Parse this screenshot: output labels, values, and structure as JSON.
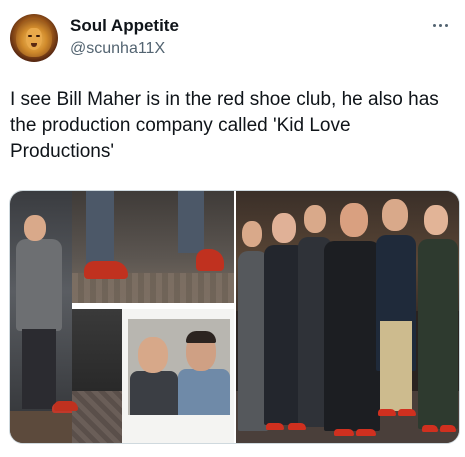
{
  "author": {
    "display_name": "Soul Appetite",
    "handle": "@scunha11X",
    "avatar_icon": "lion-avatar"
  },
  "menu": {
    "more_icon": "more-horizontal-icon"
  },
  "tweet": {
    "text": "I see Bill Maher is in the red shoe club, he also has the production company called 'Kid Love Productions'"
  },
  "media": {
    "count": 2
  },
  "colors": {
    "text": "#0f1419",
    "secondary": "#536471",
    "border": "#cfd9de",
    "shoe_red": "#c0311f"
  }
}
